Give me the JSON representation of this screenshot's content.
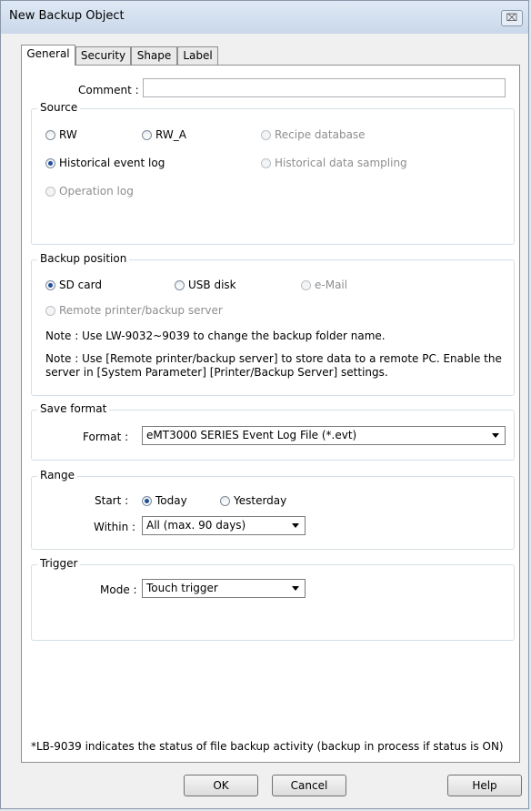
{
  "window": {
    "title": "New Backup Object",
    "close_glyph": "⌧"
  },
  "tabs": [
    "General",
    "Security",
    "Shape",
    "Label"
  ],
  "comment": {
    "label": "Comment :",
    "value": ""
  },
  "source": {
    "title": "Source",
    "options": [
      "RW",
      "RW_A",
      "Recipe database",
      "Historical event log",
      "Historical data sampling",
      "Operation log"
    ],
    "selected": "Historical event log"
  },
  "backup_position": {
    "title": "Backup position",
    "options": [
      "SD card",
      "USB disk",
      "e-Mail",
      "Remote printer/backup server"
    ],
    "selected": "SD card",
    "note1": "Note : Use LW-9032~9039 to change the backup folder name.",
    "note2_line1": "Note : Use [Remote printer/backup server] to store data to a remote PC. Enable the",
    "note2_line2": "server in [System Parameter] [Printer/Backup Server] settings."
  },
  "save_format": {
    "title": "Save format",
    "label": "Format :",
    "value": "eMT3000 SERIES Event Log File (*.evt)"
  },
  "range": {
    "title": "Range",
    "start_label": "Start :",
    "start_options": [
      "Today",
      "Yesterday"
    ],
    "start_selected": "Today",
    "within_label": "Within :",
    "within_value": "All (max. 90 days)"
  },
  "trigger": {
    "title": "Trigger",
    "mode_label": "Mode :",
    "mode_value": "Touch trigger"
  },
  "footnote": "*LB-9039 indicates the status of file backup activity (backup in process if status is ON)",
  "buttons": {
    "ok": "OK",
    "cancel": "Cancel",
    "help": "Help"
  },
  "colors": {
    "accent": "#1f4f9a",
    "group_border": "#d5dfe5",
    "titlebar": "#c9d8ea"
  }
}
